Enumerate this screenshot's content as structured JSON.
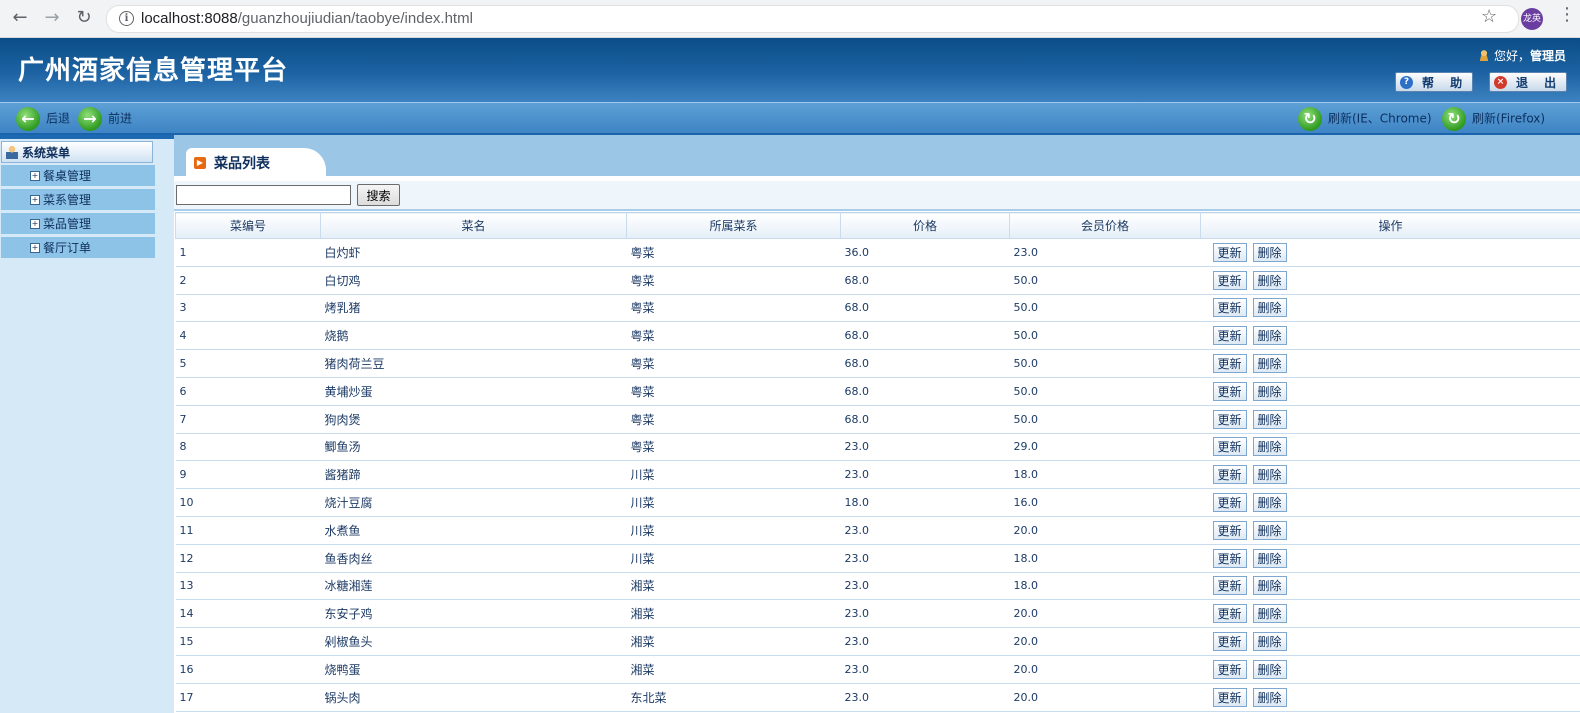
{
  "browser": {
    "url_host": "localhost:8088",
    "url_path": "/guanzhoujiudian/taobye/index.html",
    "profile_initials": "龙英"
  },
  "header": {
    "title": "广州酒家信息管理平台",
    "greeting_prefix": "您好，",
    "user": "管理员",
    "help_label": "帮 助",
    "logout_label": "退 出"
  },
  "nav": {
    "back_label": "后退",
    "forward_label": "前进",
    "refresh_ie_label": "刷新(IE、Chrome)",
    "refresh_ff_label": "刷新(Firefox)"
  },
  "sidebar": {
    "title": "系统菜单",
    "items": [
      {
        "label": "餐桌管理"
      },
      {
        "label": "菜系管理"
      },
      {
        "label": "菜品管理"
      },
      {
        "label": "餐厅订单"
      }
    ]
  },
  "content": {
    "tab_label": "菜品列表",
    "search_placeholder": "",
    "search_button": "搜索",
    "columns": [
      "菜编号",
      "菜名",
      "所属菜系",
      "价格",
      "会员价格",
      "操作"
    ],
    "update_label": "更新",
    "delete_label": "删除",
    "rows": [
      {
        "id": "1",
        "name": "白灼虾",
        "cuisine": "粤菜",
        "price": "36.0",
        "member_price": "23.0"
      },
      {
        "id": "2",
        "name": "白切鸡",
        "cuisine": "粤菜",
        "price": "68.0",
        "member_price": "50.0"
      },
      {
        "id": "3",
        "name": "烤乳猪",
        "cuisine": "粤菜",
        "price": "68.0",
        "member_price": "50.0"
      },
      {
        "id": "4",
        "name": "烧鹅",
        "cuisine": "粤菜",
        "price": "68.0",
        "member_price": "50.0"
      },
      {
        "id": "5",
        "name": "猪肉荷兰豆",
        "cuisine": "粤菜",
        "price": "68.0",
        "member_price": "50.0"
      },
      {
        "id": "6",
        "name": "黄埔炒蛋",
        "cuisine": "粤菜",
        "price": "68.0",
        "member_price": "50.0"
      },
      {
        "id": "7",
        "name": "狗肉煲",
        "cuisine": "粤菜",
        "price": "68.0",
        "member_price": "50.0"
      },
      {
        "id": "8",
        "name": "鲫鱼汤",
        "cuisine": "粤菜",
        "price": "23.0",
        "member_price": "29.0"
      },
      {
        "id": "9",
        "name": "酱猪蹄",
        "cuisine": "川菜",
        "price": "23.0",
        "member_price": "18.0"
      },
      {
        "id": "10",
        "name": "烧汁豆腐",
        "cuisine": "川菜",
        "price": "18.0",
        "member_price": "16.0"
      },
      {
        "id": "11",
        "name": "水煮鱼",
        "cuisine": "川菜",
        "price": "23.0",
        "member_price": "20.0"
      },
      {
        "id": "12",
        "name": "鱼香肉丝",
        "cuisine": "川菜",
        "price": "23.0",
        "member_price": "18.0"
      },
      {
        "id": "13",
        "name": "冰糖湘莲",
        "cuisine": "湘菜",
        "price": "23.0",
        "member_price": "18.0"
      },
      {
        "id": "14",
        "name": "东安子鸡",
        "cuisine": "湘菜",
        "price": "23.0",
        "member_price": "20.0"
      },
      {
        "id": "15",
        "name": "剁椒鱼头",
        "cuisine": "湘菜",
        "price": "23.0",
        "member_price": "20.0"
      },
      {
        "id": "16",
        "name": "烧鸭蛋",
        "cuisine": "湘菜",
        "price": "23.0",
        "member_price": "20.0"
      },
      {
        "id": "17",
        "name": "锅头肉",
        "cuisine": "东北菜",
        "price": "23.0",
        "member_price": "20.0"
      }
    ]
  },
  "icons": {
    "back": "back-arrow-icon",
    "forward": "forward-arrow-icon",
    "reload": "reload-icon",
    "info": "info-icon",
    "star": "star-icon",
    "user": "user-icon",
    "help": "help-icon",
    "logout": "logout-icon",
    "refresh": "refresh-icon",
    "menu_user": "menu-user-icon",
    "expand": "expand-icon",
    "tab": "tab-play-icon"
  },
  "colors": {
    "header_dark": "#0b4d86",
    "navbar": "#3f84c4",
    "sidebar_bg": "#d6e9f7",
    "menu_item": "#8ec3e8",
    "text": "#1d3b66"
  }
}
